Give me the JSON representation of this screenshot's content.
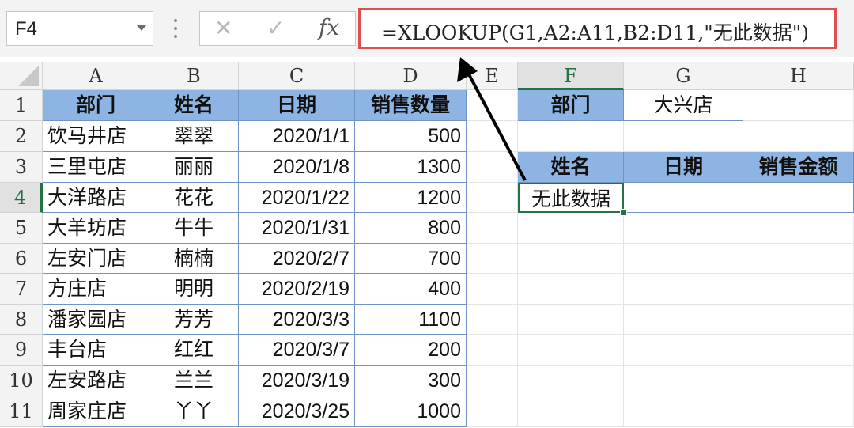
{
  "formula_bar": {
    "name_box": "F4",
    "cancel_icon": "✕",
    "enter_icon": "✓",
    "fx_label": "fx",
    "formula": "=XLOOKUP(G1,A2:A11,B2:D11,\"无此数据\")"
  },
  "columns": [
    "A",
    "B",
    "C",
    "D",
    "E",
    "F",
    "G",
    "H"
  ],
  "rows": [
    "1",
    "2",
    "3",
    "4",
    "5",
    "6",
    "7",
    "8",
    "9",
    "10",
    "11"
  ],
  "table": {
    "headers": [
      "部门",
      "姓名",
      "日期",
      "销售数量"
    ],
    "rows": [
      [
        "饮马井店",
        "翠翠",
        "2020/1/1",
        "500"
      ],
      [
        "三里屯店",
        "丽丽",
        "2020/1/8",
        "1300"
      ],
      [
        "大洋路店",
        "花花",
        "2020/1/22",
        "1200"
      ],
      [
        "大羊坊店",
        "牛牛",
        "2020/1/31",
        "800"
      ],
      [
        "左安门店",
        "楠楠",
        "2020/2/7",
        "700"
      ],
      [
        "方庄店",
        "明明",
        "2020/2/19",
        "400"
      ],
      [
        "潘家园店",
        "芳芳",
        "2020/3/3",
        "1100"
      ],
      [
        "丰台店",
        "红红",
        "2020/3/7",
        "200"
      ],
      [
        "左安路店",
        "兰兰",
        "2020/3/19",
        "300"
      ],
      [
        "周家庄店",
        "丫丫",
        "2020/3/25",
        "1000"
      ]
    ]
  },
  "lookup": {
    "label": "部门",
    "value": "大兴店"
  },
  "result": {
    "headers": [
      "姓名",
      "日期",
      "销售金额"
    ],
    "values": [
      "无此数据",
      "",
      ""
    ]
  },
  "colors": {
    "header_fill": "#8db4e2",
    "selection": "#217346",
    "formula_highlight": "#e05050"
  }
}
